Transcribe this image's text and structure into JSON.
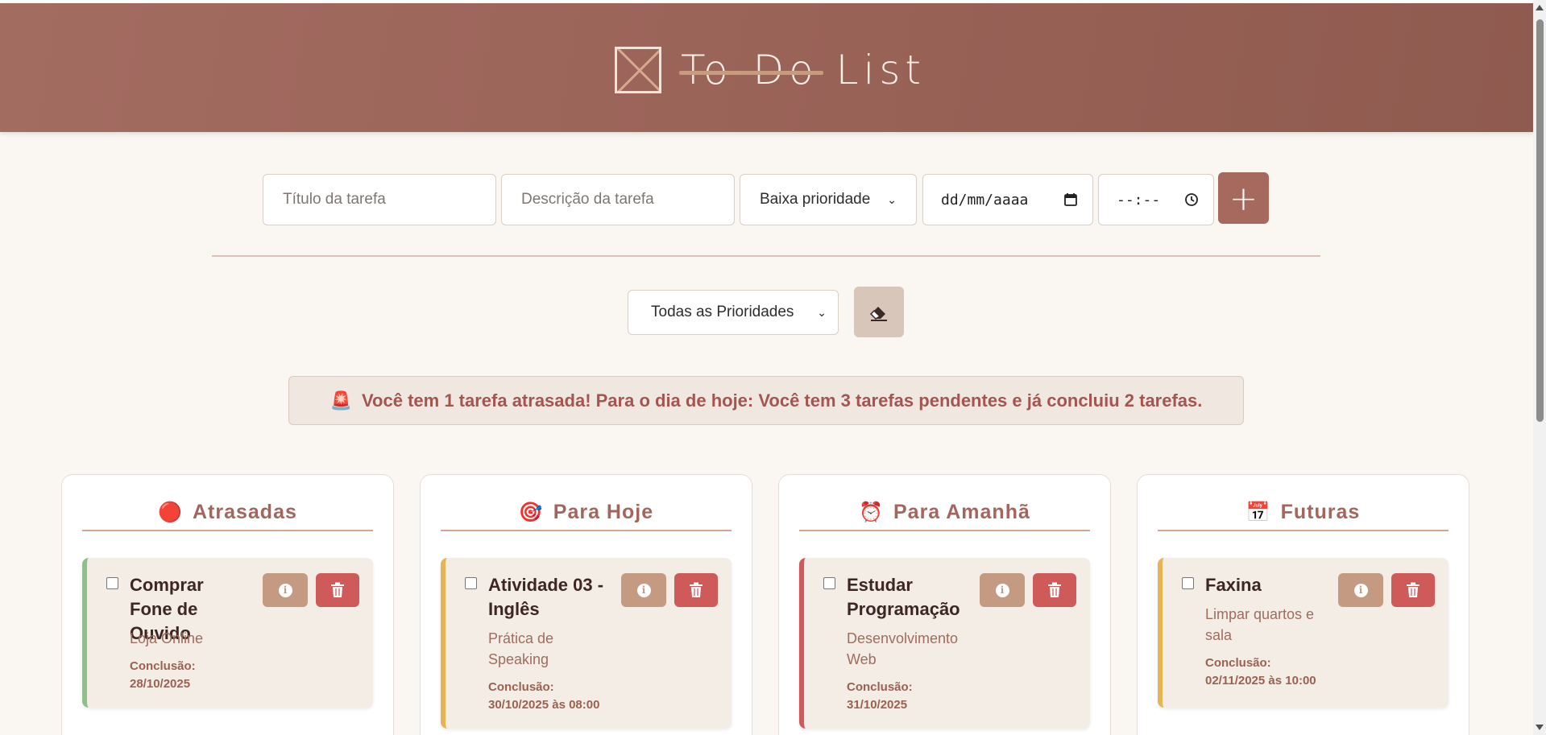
{
  "header": {
    "title_struck": "To-Do",
    "title_rest": " List"
  },
  "form": {
    "title_placeholder": "Título da tarefa",
    "description_placeholder": "Descrição da tarefa",
    "priority_value": "Baixa prioridade",
    "date_placeholder": "dd/mm/aaaa",
    "time_placeholder": "--:--",
    "add_label": "+"
  },
  "filter": {
    "priority_value": "Todas as Prioridades"
  },
  "alert": {
    "emoji": "🚨",
    "text": "Você tem 1 tarefa atrasada! Para o dia de hoje: Você tem 3 tarefas pendentes e já concluiu 2 tarefas."
  },
  "columns": [
    {
      "icon": "🔴",
      "title": "Atrasadas",
      "task": {
        "name": "Comprar Fone de Ouvido",
        "description": "Loja Online",
        "due_label": "Conclusão:",
        "due_value": "28/10/2025",
        "priority_color": "#8fbf8b"
      }
    },
    {
      "icon": "🎯",
      "title": "Para Hoje",
      "task": {
        "name": "Atividade 03 - Inglês",
        "description": "Prática de Speaking",
        "due_label": "Conclusão:",
        "due_value": "30/10/2025 às 08:00",
        "priority_color": "#e7b453"
      }
    },
    {
      "icon": "⏰",
      "title": "Para Amanhã",
      "task": {
        "name": "Estudar Programação",
        "description": "Desenvolvimento Web",
        "due_label": "Conclusão:",
        "due_value": "31/10/2025",
        "priority_color": "#cf5a5a"
      }
    },
    {
      "icon": "📅",
      "title": "Futuras",
      "task": {
        "name": "Faxina",
        "description": "Limpar quartos e sala",
        "due_label": "Conclusão:",
        "due_value": "02/11/2025 às 10:00",
        "priority_color": "#e7b453"
      }
    }
  ],
  "colors": {
    "accent": "#a6695d",
    "header": "#9a6358",
    "danger": "#cf5a5a",
    "info": "#c49a82"
  }
}
